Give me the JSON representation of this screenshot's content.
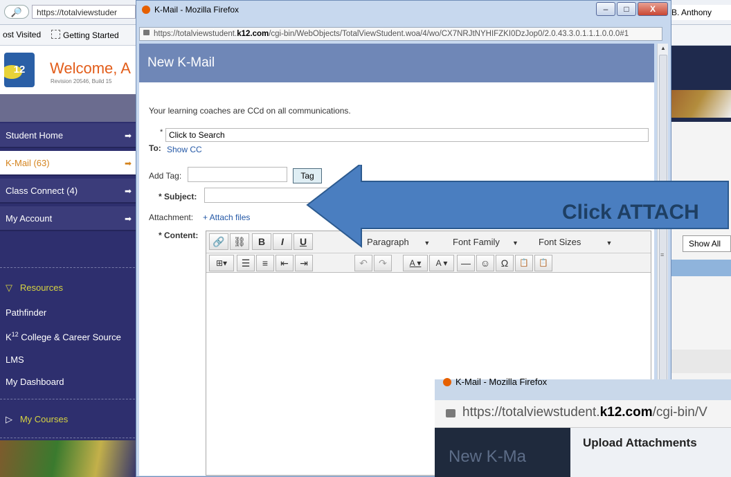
{
  "background": {
    "url": "https://totalviewstuder",
    "user": "B. Anthony",
    "bookmarks": [
      "ost Visited",
      "Getting Started"
    ],
    "welcome": "Welcome, A",
    "revision": "Revision 20546, Build 15",
    "logo_text": "12",
    "nav": [
      {
        "label": "Student Home"
      },
      {
        "label": "K-Mail (63)"
      },
      {
        "label": "Class Connect (4)"
      },
      {
        "label": "My Account"
      }
    ],
    "resources_heading": "Resources",
    "resources": [
      "Pathfinder",
      "K",
      "12",
      " College & Career Source",
      "LMS",
      "My Dashboard"
    ],
    "my_courses": "My Courses",
    "show_all": "Show All"
  },
  "popup": {
    "title": "K-Mail - Mozilla Firefox",
    "url_prefix": "https://totalviewstudent.",
    "url_domain": "k12.com",
    "url_rest": "/cgi-bin/WebObjects/TotalViewStudent.woa/4/wo/CX7NRJtNYHIFZKI0DzJop0/2.0.43.3.0.1.1.1.0.0.0#1",
    "controls": {
      "minimize": "–",
      "maximize": "□",
      "close": "X"
    },
    "heading": "New K-Mail",
    "notice": "Your learning coaches are CCd on all communications.",
    "to": {
      "star": "*",
      "placeholder": "Click to Search",
      "label": "To:",
      "show_cc": "Show CC"
    },
    "tag": {
      "label": "Add Tag:",
      "button": "Tag"
    },
    "subject_label": "* Subject:",
    "attachment": {
      "label": "Attachment:",
      "link": "+ Attach files"
    },
    "content_label": "* Content:",
    "toolbar": {
      "link": "🔗",
      "unlink": "⛓",
      "bold": "B",
      "italic": "I",
      "underline": "U",
      "paragraph": "Paragraph",
      "font_family": "Font Family",
      "font_sizes": "Font Sizes",
      "row2": [
        "⊞▾",
        "☰",
        "≡",
        "⇤",
        "⇥",
        "↶",
        "↷",
        "A ▾",
        "A ▾",
        "—",
        "☺",
        "Ω",
        "📋",
        "📋"
      ]
    }
  },
  "annotation": {
    "text": "Click ATTACH",
    "arrow_color": "#4a7ec0"
  },
  "upload": {
    "title": "K-Mail - Mozilla Firefox",
    "url_prefix": "https://totalviewstudent.",
    "url_domain": "k12.com",
    "url_rest": "/cgi-bin/V",
    "kmail": "New K-Ma",
    "panel_title": "Upload Attachments"
  }
}
